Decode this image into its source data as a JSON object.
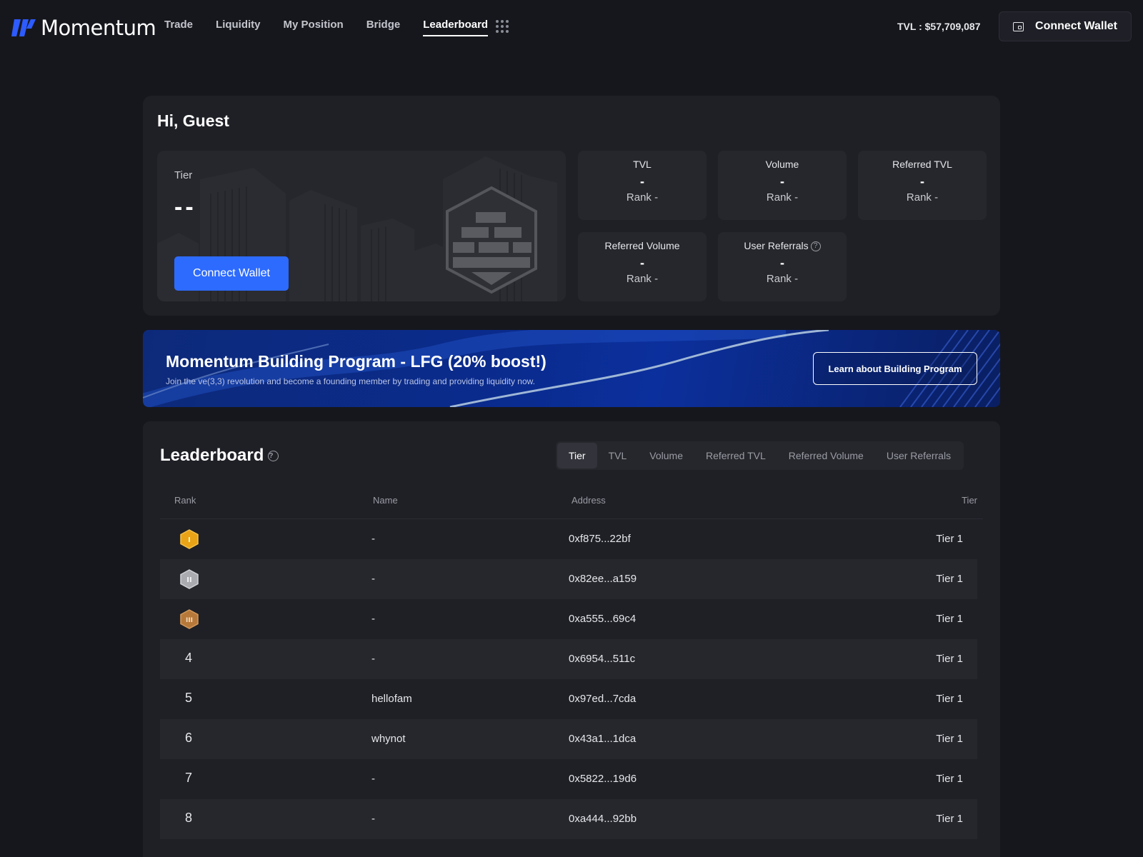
{
  "nav": {
    "brand": "Momentum",
    "links": [
      "Trade",
      "Liquidity",
      "My Position",
      "Bridge",
      "Leaderboard"
    ],
    "active": "Leaderboard",
    "tvl": "TVL : $57,709,087",
    "connect_label": "Connect Wallet"
  },
  "hero": {
    "greeting": "Hi, Guest",
    "tier_label": "Tier",
    "tier_value": "--",
    "connect_label": "Connect Wallet",
    "stats": [
      {
        "title": "TVL",
        "value": "-",
        "rank": "Rank  -"
      },
      {
        "title": "Volume",
        "value": "-",
        "rank": "Rank  -"
      },
      {
        "title": "Referred TVL",
        "value": "-",
        "rank": "Rank  -"
      },
      {
        "title": "Referred Volume",
        "value": "-",
        "rank": "Rank  -"
      },
      {
        "title": "User Referrals",
        "value": "-",
        "rank": "Rank  -"
      }
    ]
  },
  "banner": {
    "title": "Momentum Building Program - LFG (20% boost!)",
    "subtitle": "Join the ve(3,3) revolution and become a founding member by trading and providing liquidity now.",
    "button": "Learn about Building Program"
  },
  "leaderboard": {
    "title": "Leaderboard",
    "tabs": [
      "Tier",
      "TVL",
      "Volume",
      "Referred TVL",
      "Referred Volume",
      "User Referrals"
    ],
    "active_tab": "Tier",
    "columns": [
      "Rank",
      "Name",
      "Address",
      "Tier"
    ],
    "rows": [
      {
        "rank": "1",
        "medal": "gold",
        "name": "-",
        "address": "0xf875...22bf",
        "tier": "Tier 1"
      },
      {
        "rank": "2",
        "medal": "silver",
        "name": "-",
        "address": "0x82ee...a159",
        "tier": "Tier 1"
      },
      {
        "rank": "3",
        "medal": "bronze",
        "name": "-",
        "address": "0xa555...69c4",
        "tier": "Tier 1"
      },
      {
        "rank": "4",
        "name": "-",
        "address": "0x6954...511c",
        "tier": "Tier 1"
      },
      {
        "rank": "5",
        "name": "hellofam",
        "address": "0x97ed...7cda",
        "tier": "Tier 1"
      },
      {
        "rank": "6",
        "name": "whynot",
        "address": "0x43a1...1dca",
        "tier": "Tier 1"
      },
      {
        "rank": "7",
        "name": "-",
        "address": "0x5822...19d6",
        "tier": "Tier 1"
      },
      {
        "rank": "8",
        "name": "-",
        "address": "0xa444...92bb",
        "tier": "Tier 1"
      }
    ]
  },
  "colors": {
    "background": "#16171d",
    "card": "#1f2026",
    "accent": "#2d6bff",
    "gold": "#e8a317",
    "silver": "#a9abb1",
    "bronze": "#b7793a"
  }
}
